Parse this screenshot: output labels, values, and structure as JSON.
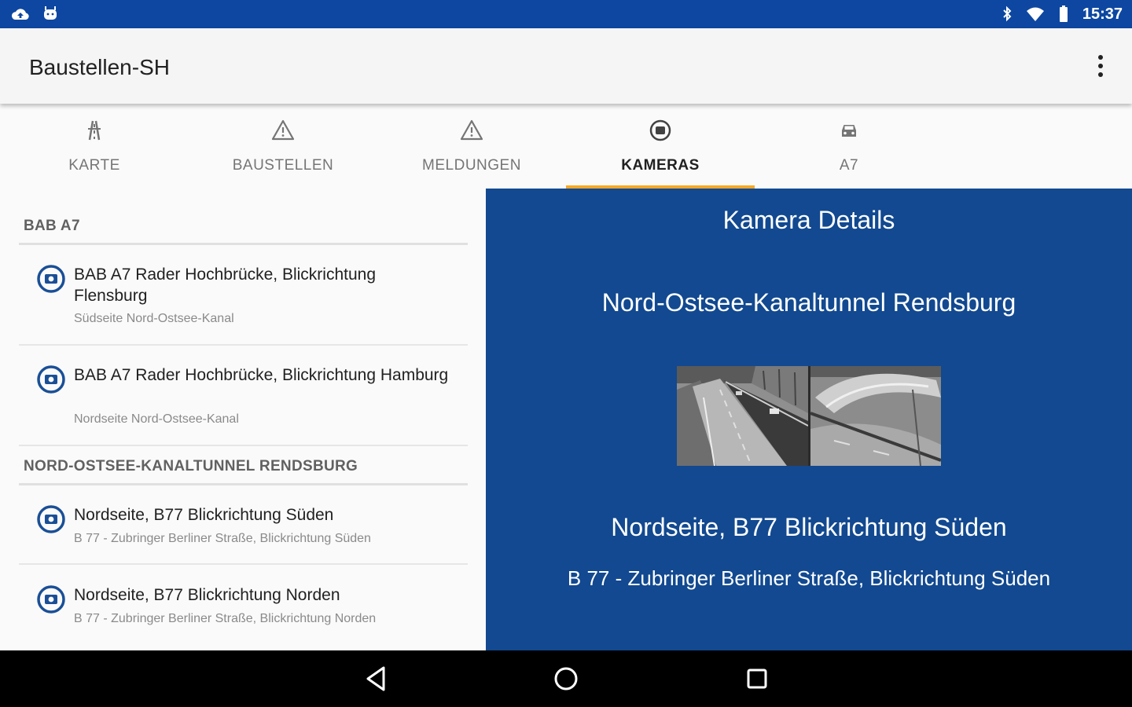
{
  "status_bar": {
    "time": "15:37",
    "left_icons": [
      "cloud-upload-icon",
      "android-icon"
    ],
    "right_icons": [
      "bluetooth-icon",
      "wifi-icon",
      "battery-icon"
    ]
  },
  "app_bar": {
    "title": "Baustellen-SH",
    "overflow_icon": "more-vert-icon"
  },
  "tabs": [
    {
      "label": "KARTE",
      "icon": "road-icon",
      "active": false
    },
    {
      "label": "BAUSTELLEN",
      "icon": "warning-triangle-icon",
      "active": false
    },
    {
      "label": "MELDUNGEN",
      "icon": "warning-triangle-icon",
      "active": false
    },
    {
      "label": "KAMERAS",
      "icon": "camera-icon",
      "active": true
    },
    {
      "label": "A7",
      "icon": "car-icon",
      "active": false
    }
  ],
  "list": {
    "sections": [
      {
        "header": "BAB A7",
        "items": [
          {
            "title": "BAB A7 Rader Hochbrücke, Blickrichtung Flensburg",
            "subtitle": "Südseite Nord-Ostsee-Kanal"
          },
          {
            "title": "BAB A7 Rader Hochbrücke, Blickrichtung Hamburg",
            "subtitle": "Nordseite Nord-Ostsee-Kanal"
          }
        ]
      },
      {
        "header": "NORD-OSTSEE-KANALTUNNEL RENDSBURG",
        "items": [
          {
            "title": "Nordseite, B77 Blickrichtung Süden",
            "subtitle": "B 77 - Zubringer Berliner Straße, Blickrichtung Süden"
          },
          {
            "title": "Nordseite, B77 Blickrichtung Norden",
            "subtitle": "B 77 - Zubringer Berliner Straße, Blickrichtung Norden"
          }
        ]
      }
    ]
  },
  "detail": {
    "heading": "Kamera Details",
    "location": "Nord-Ostsee-Kanaltunnel Rendsburg",
    "camera_name": "Nordseite, B77 Blickrichtung Süden",
    "camera_description": "B 77 - Zubringer Berliner Straße, Blickrichtung Süden"
  },
  "colors": {
    "status_bar": "#0d47a1",
    "detail_background": "#124990",
    "tab_indicator": "#f9a825",
    "camera_icon": "#1a4f96"
  },
  "nav_bar": {
    "icons": [
      "back-icon",
      "home-icon",
      "recents-icon"
    ]
  }
}
